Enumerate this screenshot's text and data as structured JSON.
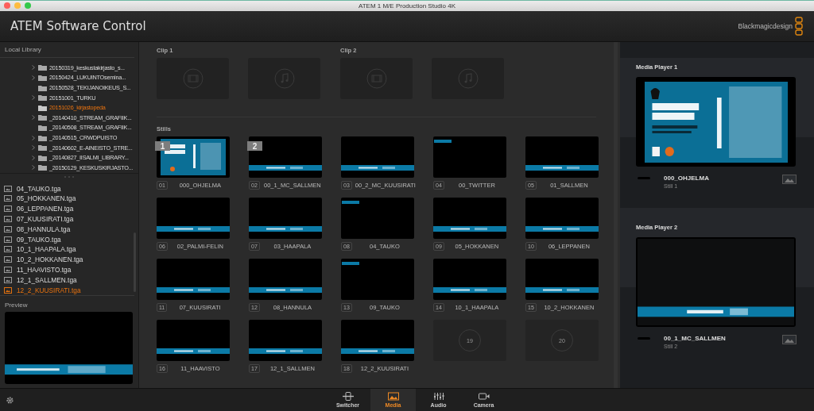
{
  "window": {
    "title": "ATEM 1 M/E Production Studio 4K"
  },
  "header": {
    "app_title": "ATEM Software Control",
    "brand": "Blackmagicdesign"
  },
  "library": {
    "title": "Local Library",
    "folders": [
      {
        "name": "20150319_keskustakirjasto_s...",
        "expandable": true,
        "selected": false
      },
      {
        "name": "20150424_LUKUINTOsemina...",
        "expandable": true,
        "selected": false
      },
      {
        "name": "20150528_TEKIJANOIKEUS_S...",
        "expandable": false,
        "selected": false
      },
      {
        "name": "20151001_TURKU",
        "expandable": true,
        "selected": false
      },
      {
        "name": "20151026_kirjastopeda",
        "expandable": false,
        "selected": true
      },
      {
        "name": "_20140410_STREAM_GRAFIIK...",
        "expandable": true,
        "selected": false
      },
      {
        "name": "_20140508_STREAM_GRAFIIK...",
        "expandable": false,
        "selected": false
      },
      {
        "name": "_20140515_CRWDPUISTO",
        "expandable": true,
        "selected": false
      },
      {
        "name": "_20140602_E-AINEISTO_STRE...",
        "expandable": true,
        "selected": false
      },
      {
        "name": "_20140827_IISALMI_LIBRARY...",
        "expandable": true,
        "selected": false
      },
      {
        "name": "_20150129_KESKUSKIRJASTO...",
        "expandable": true,
        "selected": false
      }
    ],
    "files": [
      {
        "name": "04_TAUKO.tga",
        "selected": false
      },
      {
        "name": "05_HOKKANEN.tga",
        "selected": false
      },
      {
        "name": "06_LEPPANEN.tga",
        "selected": false
      },
      {
        "name": "07_KUUSIRATI.tga",
        "selected": false
      },
      {
        "name": "08_HANNULA.tga",
        "selected": false
      },
      {
        "name": "09_TAUKO.tga",
        "selected": false
      },
      {
        "name": "10_1_HAAPALA.tga",
        "selected": false
      },
      {
        "name": "10_2_HOKKANEN.tga",
        "selected": false
      },
      {
        "name": "11_HAAVISTO.tga",
        "selected": false
      },
      {
        "name": "12_1_SALLMEN.tga",
        "selected": false
      },
      {
        "name": "12_2_KUUSIRATI.tga",
        "selected": true
      }
    ]
  },
  "preview": {
    "title": "Preview",
    "image": {
      "kind": "lower-third"
    }
  },
  "clips": [
    {
      "title": "Clip 1",
      "slots": [
        {
          "kind": "video"
        },
        {
          "kind": "audio"
        }
      ]
    },
    {
      "title": "Clip 2",
      "slots": [
        {
          "kind": "video"
        },
        {
          "kind": "audio"
        }
      ]
    }
  ],
  "stills": {
    "title": "Stills",
    "items": [
      {
        "number": "01",
        "name": "000_OHJELMA",
        "kind": "slide",
        "player_badge": "1"
      },
      {
        "number": "02",
        "name": "00_1_MC_SALLMEN",
        "kind": "lower-third",
        "player_badge": "2"
      },
      {
        "number": "03",
        "name": "00_2_MC_KUUSIRATI",
        "kind": "lower-third"
      },
      {
        "number": "04",
        "name": "00_TWITTER",
        "kind": "top-tag"
      },
      {
        "number": "05",
        "name": "01_SALLMEN",
        "kind": "lower-third"
      },
      {
        "number": "06",
        "name": "02_PALMI-FELIN",
        "kind": "lower-third"
      },
      {
        "number": "07",
        "name": "03_HAAPALA",
        "kind": "lower-third"
      },
      {
        "number": "08",
        "name": "04_TAUKO",
        "kind": "top-tag"
      },
      {
        "number": "09",
        "name": "05_HOKKANEN",
        "kind": "lower-third"
      },
      {
        "number": "10",
        "name": "06_LEPPANEN",
        "kind": "lower-third"
      },
      {
        "number": "11",
        "name": "07_KUUSIRATI",
        "kind": "lower-third"
      },
      {
        "number": "12",
        "name": "08_HANNULA",
        "kind": "lower-third"
      },
      {
        "number": "13",
        "name": "09_TAUKO",
        "kind": "top-tag"
      },
      {
        "number": "14",
        "name": "10_1_HAAPALA",
        "kind": "lower-third"
      },
      {
        "number": "15",
        "name": "10_2_HOKKANEN",
        "kind": "lower-third"
      },
      {
        "number": "16",
        "name": "11_HAAVISTO",
        "kind": "lower-third"
      },
      {
        "number": "17",
        "name": "12_1_SALLMEN",
        "kind": "lower-third"
      },
      {
        "number": "18",
        "name": "12_2_KUUSIRATI",
        "kind": "lower-third"
      },
      {
        "number": "19",
        "kind": "empty"
      },
      {
        "number": "20",
        "kind": "empty"
      }
    ]
  },
  "media_players": [
    {
      "title": "Media Player 1",
      "image": {
        "kind": "slide"
      },
      "clip_name": "000_OHJELMA",
      "source": "Still 1"
    },
    {
      "title": "Media Player 2",
      "image": {
        "kind": "lower-third"
      },
      "clip_name": "00_1_MC_SALLMEN",
      "source": "Still 2"
    }
  ],
  "bottom_tabs": [
    {
      "label": "Switcher",
      "kind": "switcher",
      "selected": false
    },
    {
      "label": "Media",
      "kind": "media",
      "selected": true
    },
    {
      "label": "Audio",
      "kind": "audio",
      "selected": false
    },
    {
      "label": "Camera",
      "kind": "camera",
      "selected": false
    }
  ]
}
